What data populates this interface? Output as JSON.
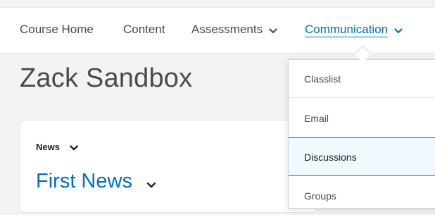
{
  "nav": {
    "items": [
      {
        "label": "Course Home"
      },
      {
        "label": "Content"
      },
      {
        "label": "Assessments"
      },
      {
        "label": "Communication"
      }
    ]
  },
  "page": {
    "title": "Zack Sandbox"
  },
  "widget": {
    "header": "News",
    "news_title": "First News"
  },
  "dropdown": {
    "items": [
      {
        "label": "Classlist"
      },
      {
        "label": "Email"
      },
      {
        "label": "Discussions",
        "highlighted": true
      },
      {
        "label": "Groups"
      }
    ]
  },
  "colors": {
    "accent": "#006fbf",
    "text": "#494c4e",
    "background": "#f2f3f5",
    "highlight_bg": "#f1f9fe"
  },
  "icons": [
    "chevron-down-icon"
  ]
}
